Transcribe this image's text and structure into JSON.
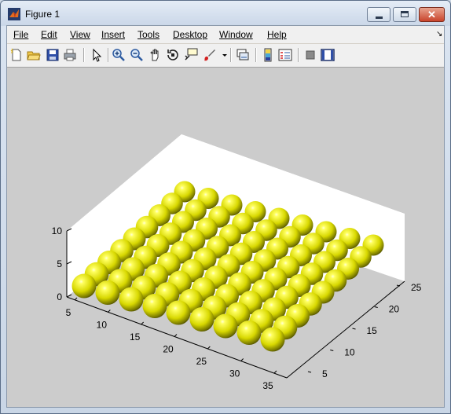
{
  "window": {
    "title": "Figure 1",
    "close_glyph": "✕"
  },
  "menu": {
    "items": [
      "File",
      "Edit",
      "View",
      "Insert",
      "Tools",
      "Desktop",
      "Window",
      "Help"
    ],
    "dock_glyph": "↘"
  },
  "toolbar": {
    "icons": [
      "new-figure-icon",
      "open-file-icon",
      "save-icon",
      "print-icon",
      "edit-plot-arrow-icon",
      "zoom-in-icon",
      "zoom-out-icon",
      "pan-hand-icon",
      "rotate-3d-icon",
      "data-cursor-icon",
      "brush-icon",
      "brush-dropdown-icon",
      "link-plot-icon",
      "colorbar-icon",
      "legend-icon",
      "hide-plot-tools-icon",
      "show-plot-tools-icon"
    ]
  },
  "chart_data": {
    "type": "scatter",
    "description_type": "3d-spheres",
    "z_ticks": [
      "0",
      "5",
      "10"
    ],
    "x_ticks": [
      "5",
      "10",
      "15",
      "20",
      "25",
      "30",
      "35"
    ],
    "y_ticks": [
      "5",
      "10",
      "15",
      "20",
      "25"
    ],
    "sphere_color": "#e8e800",
    "grid": false,
    "background": "#cccccc",
    "pane_color": "#ffffff"
  }
}
